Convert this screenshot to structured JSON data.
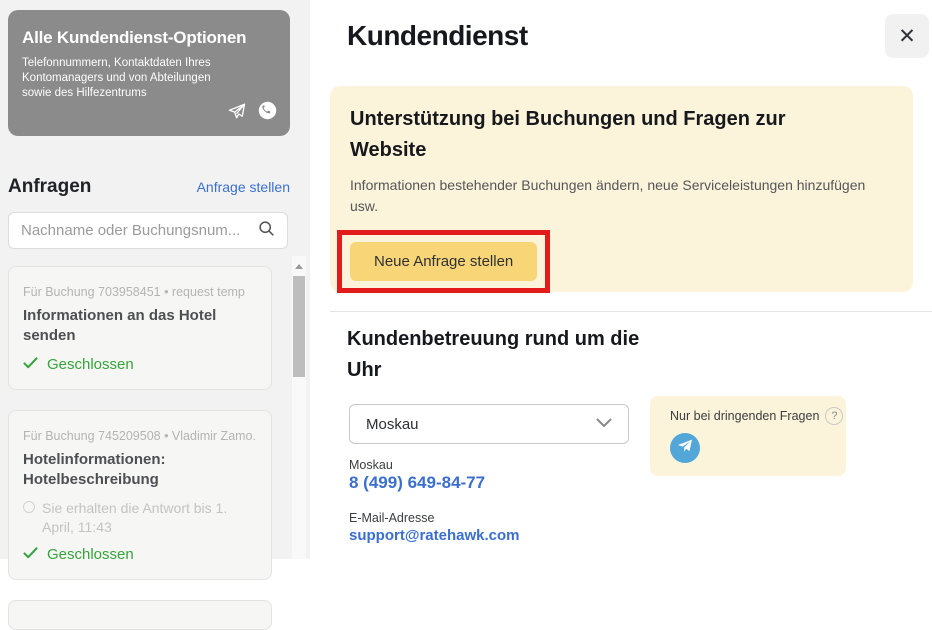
{
  "sidebar": {
    "promo_card": {
      "title": "Alle Kundendienst-Optionen",
      "description": "Telefonnummern, Kontaktdaten Ihres Kontomanagers und von Abteilungen sowie des Hilfezentrums",
      "icons": [
        "telegram-icon",
        "whatsapp-icon"
      ]
    },
    "requests": {
      "heading": "Anfragen",
      "create_link_label": "Anfrage stellen",
      "search_placeholder": "Nachname oder Buchungsnum...",
      "search_icon": "magnifier-icon",
      "items": [
        {
          "meta": "Für Buchung 703958451 • request temp",
          "title": "Informationen an das Hotel senden",
          "status": "Geschlossen",
          "status_icon": "check-icon"
        },
        {
          "meta": "Für Buchung 745209508 • Vladimir Zamo...",
          "title": "Hotelinformationen: Hotelbeschreibung",
          "note": "Sie erhalten die Antwort bis 1. April, 11:43",
          "note_icon": "clock-icon",
          "status": "Geschlossen",
          "status_icon": "check-icon"
        }
      ]
    }
  },
  "main": {
    "title": "Kundendienst",
    "close_glyph": "✕",
    "support_box": {
      "heading": "Unterstützung bei Buchungen und Fragen zur Website",
      "description": "Informationen bestehender Buchungen ändern, neue Serviceleistungen hinzufügen usw.",
      "button_label": "Neue Anfrage stellen"
    },
    "availability": {
      "heading": "Kundenbetreuung rund um die Uhr",
      "city_select_value": "Moskau",
      "phone_label": "Moskau",
      "phone": "8 (499) 649-84-77",
      "email_label": "E-Mail-Adresse",
      "email": "support@ratehawk.com",
      "urgent_box": {
        "label": "Nur bei dringenden Fragen",
        "help_glyph": "?"
      }
    }
  },
  "colors": {
    "cream_panel": "#fbf4da",
    "cta_yellow": "#f8d678",
    "annotation_red": "#e21b1b",
    "link_blue": "#3a6fd0",
    "status_green": "#35a43a",
    "promo_gray": "#8b8b8b",
    "telegram_blue": "#53a7d8"
  }
}
